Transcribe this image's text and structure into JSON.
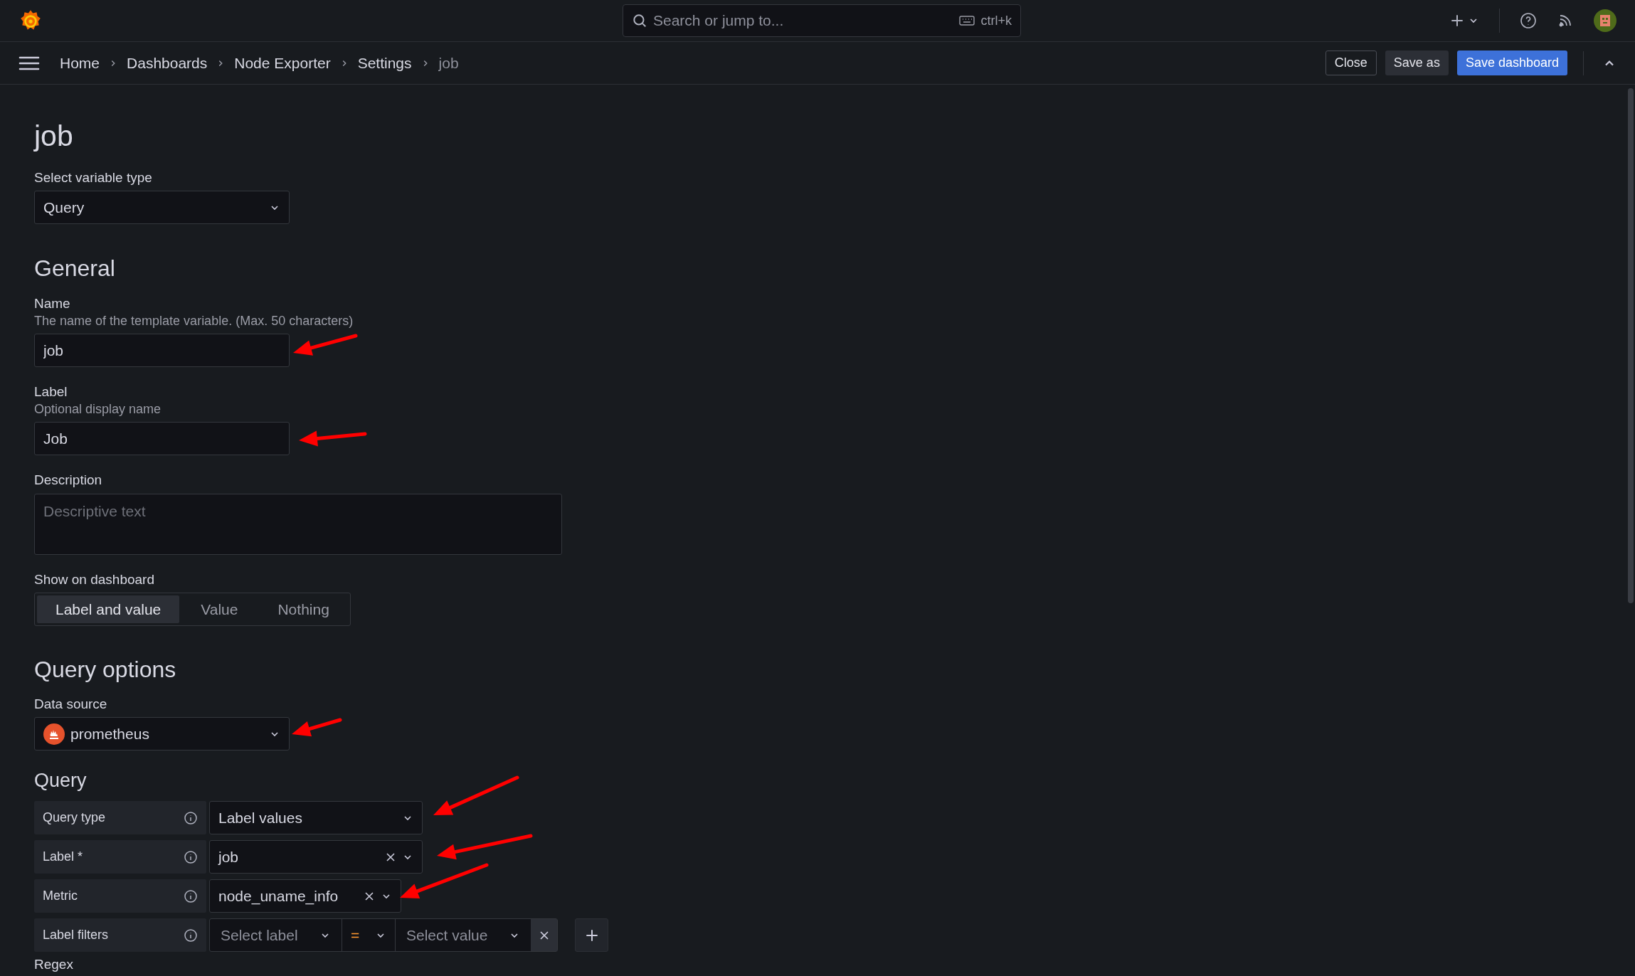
{
  "top_bar": {
    "search": {
      "placeholder": "Search or jump to...",
      "shortcut": "ctrl+k"
    }
  },
  "breadcrumbs": [
    {
      "label": "Home",
      "current": false
    },
    {
      "label": "Dashboards",
      "current": false
    },
    {
      "label": "Node Exporter",
      "current": false
    },
    {
      "label": "Settings",
      "current": false
    },
    {
      "label": "job",
      "current": true
    }
  ],
  "actions": [
    {
      "label": "Close",
      "kind": "outline"
    },
    {
      "label": "Save as",
      "kind": "secondary"
    },
    {
      "label": "Save dashboard",
      "kind": "primary"
    }
  ],
  "page_title": "job",
  "variable_type": {
    "label": "Select variable type",
    "value": "Query"
  },
  "general": {
    "heading": "General",
    "name": {
      "label": "Name",
      "description": "The name of the template variable. (Max. 50 characters)",
      "value": "job"
    },
    "label": {
      "label": "Label",
      "description": "Optional display name",
      "value": "Job"
    },
    "description": {
      "label": "Description",
      "placeholder": "Descriptive text"
    },
    "show_on_dashboard": {
      "label": "Show on dashboard",
      "options": [
        {
          "label": "Label and value",
          "selected": true
        },
        {
          "label": "Value",
          "selected": false
        },
        {
          "label": "Nothing",
          "selected": false
        }
      ]
    }
  },
  "query_options": {
    "heading": "Query options",
    "data_source": {
      "label": "Data source",
      "value": "prometheus"
    }
  },
  "query": {
    "heading": "Query",
    "rows": [
      {
        "label": "Query type",
        "kind": "select",
        "value": "Label values",
        "clearable": false
      },
      {
        "label": "Label *",
        "kind": "select",
        "value": "job",
        "clearable": true
      },
      {
        "label": "Metric",
        "kind": "select",
        "value": "node_uname_info",
        "clearable": true
      },
      {
        "label": "Label filters",
        "kind": "filters",
        "label_placeholder": "Select label",
        "operator": "=",
        "value_placeholder": "Select value"
      }
    ]
  },
  "regex": {
    "label": "Regex"
  }
}
